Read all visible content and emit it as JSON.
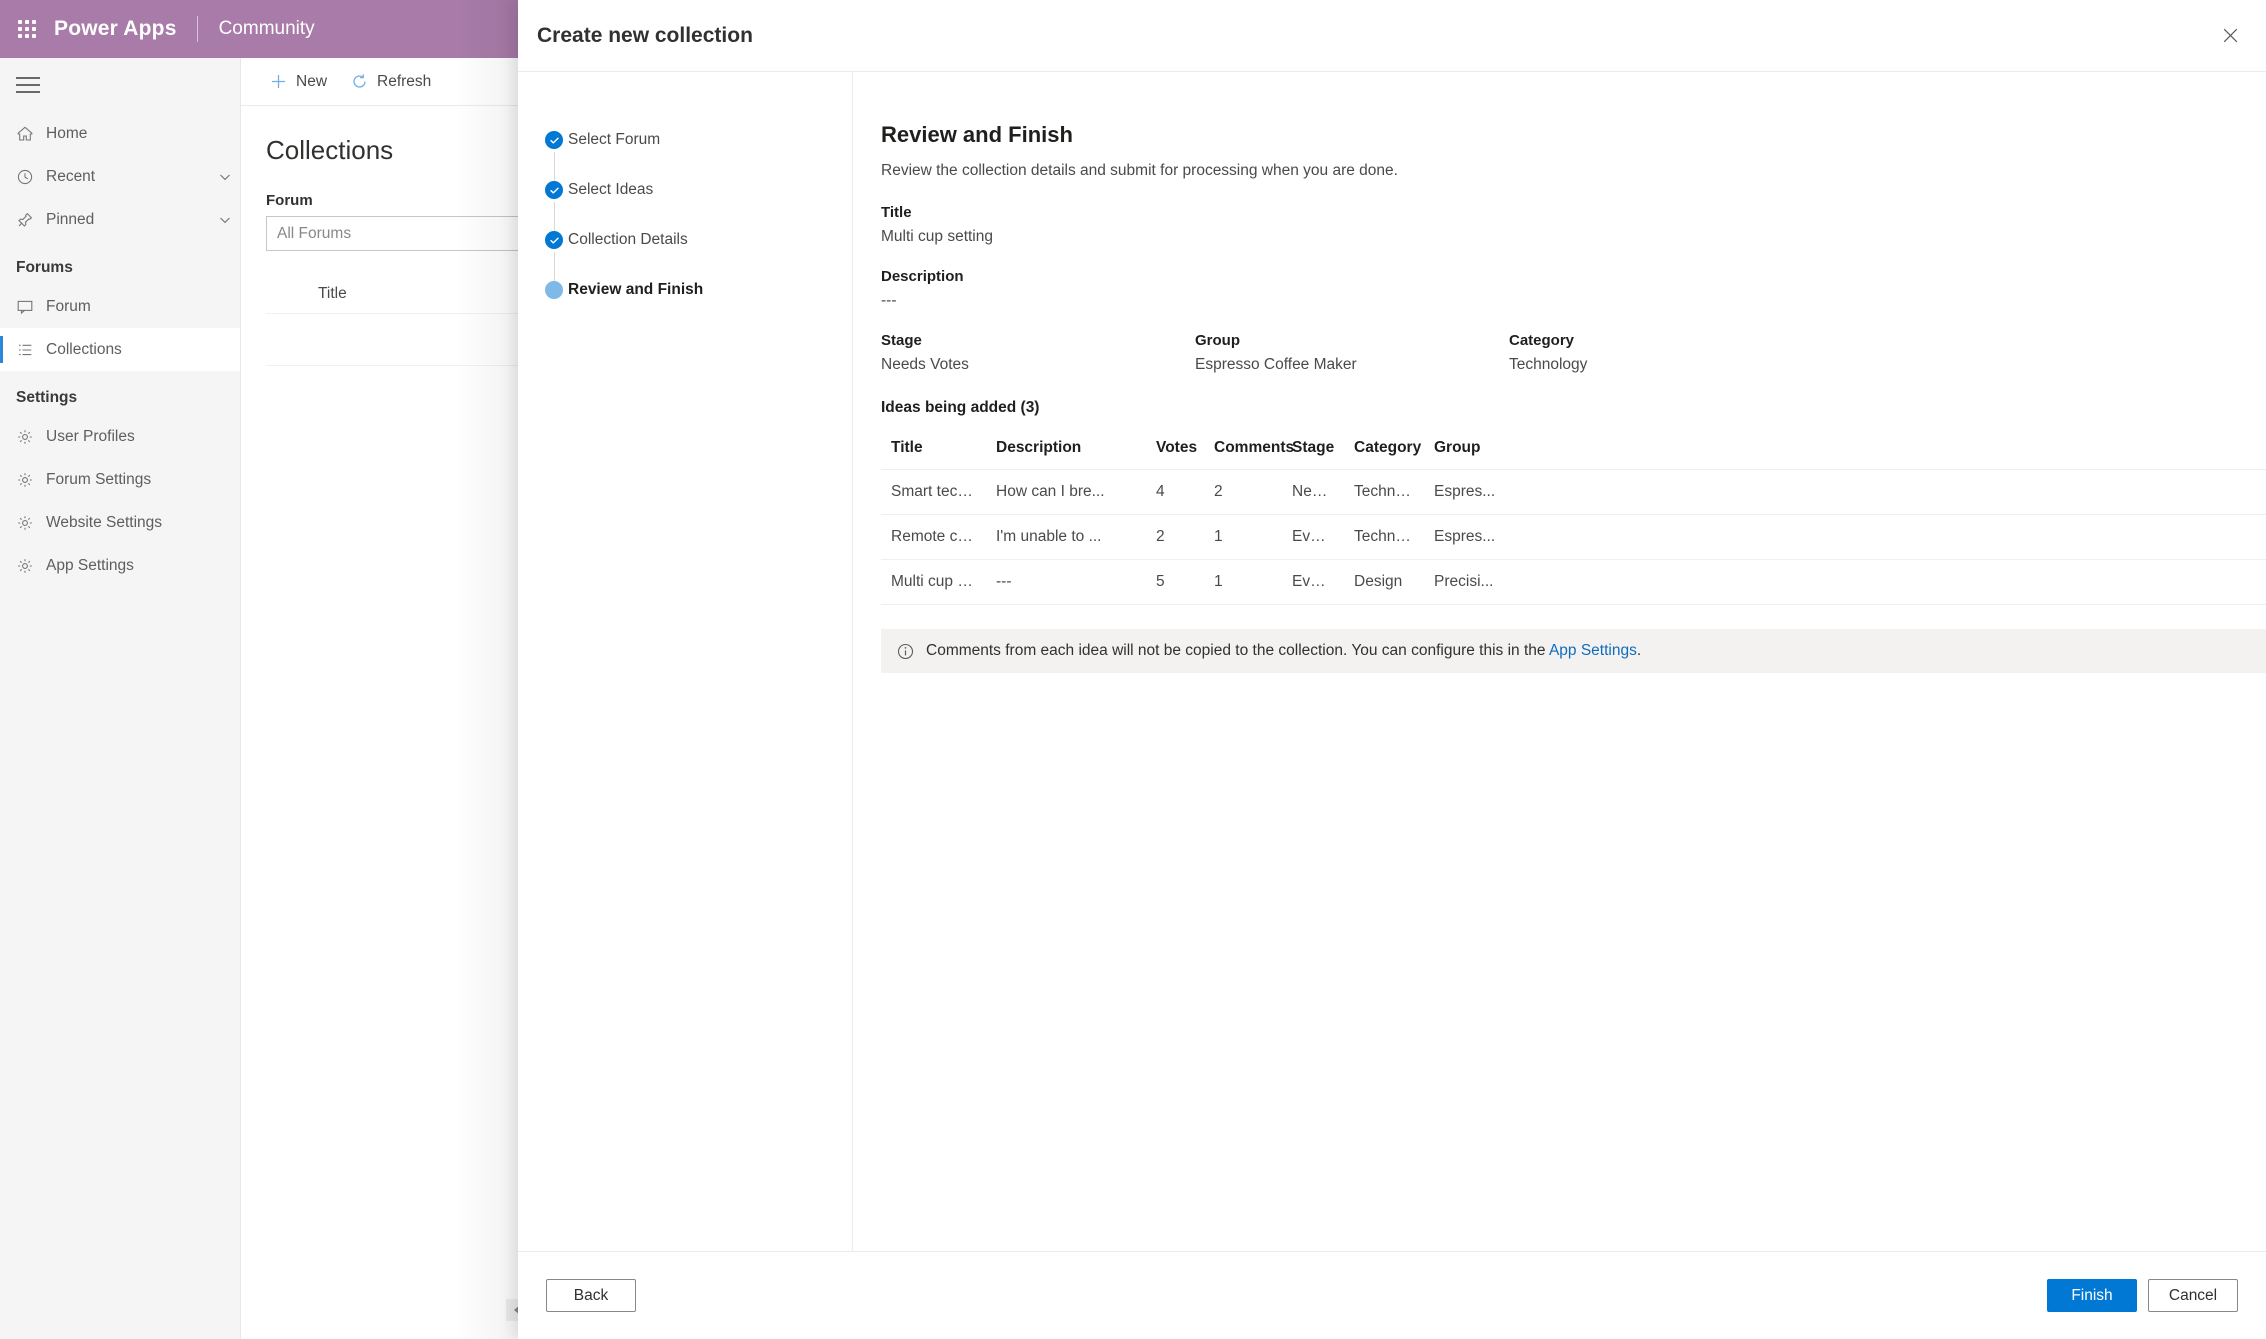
{
  "topbar": {
    "waffle_icon": "waffle-grid-icon",
    "brand": "Power Apps",
    "sub_brand": "Community",
    "bg_color": "#a87ba8"
  },
  "sidebar": {
    "menu_icon": "hamburger-icon",
    "items": [
      {
        "label": "Home",
        "icon": "home-icon",
        "chevron": false,
        "selected": false
      },
      {
        "label": "Recent",
        "icon": "clock-icon",
        "chevron": true,
        "selected": false
      },
      {
        "label": "Pinned",
        "icon": "pin-icon",
        "chevron": true,
        "selected": false
      }
    ],
    "group_forums": "Forums",
    "forum_items": [
      {
        "label": "Forum",
        "icon": "chat-icon",
        "selected": false
      },
      {
        "label": "Collections",
        "icon": "list-icon",
        "selected": true
      }
    ],
    "group_settings": "Settings",
    "settings_items": [
      {
        "label": "User Profiles",
        "icon": "gear-icon"
      },
      {
        "label": "Forum Settings",
        "icon": "gear-icon"
      },
      {
        "label": "Website Settings",
        "icon": "gear-icon"
      },
      {
        "label": "App Settings",
        "icon": "gear-icon"
      }
    ]
  },
  "main": {
    "commands": [
      {
        "label": "New",
        "icon": "plus-icon"
      },
      {
        "label": "Refresh",
        "icon": "refresh-icon"
      }
    ],
    "page_title": "Collections",
    "forum_field_label": "Forum",
    "forum_value": "All Forums",
    "list_column_title": "Title"
  },
  "dialog": {
    "title": "Create new collection",
    "close_icon": "close-icon",
    "steps": [
      {
        "label": "Select Forum",
        "state": "done"
      },
      {
        "label": "Select Ideas",
        "state": "done"
      },
      {
        "label": "Collection Details",
        "state": "done"
      },
      {
        "label": "Review and Finish",
        "state": "current"
      }
    ],
    "section_title": "Review and Finish",
    "section_subtitle": "Review the collection details and submit for processing when you are done.",
    "fields": {
      "title_label": "Title",
      "title_value": "Multi cup setting",
      "description_label": "Description",
      "description_value": "---",
      "stage_label": "Stage",
      "stage_value": "Needs Votes",
      "group_label": "Group",
      "group_value": "Espresso Coffee Maker",
      "category_label": "Category",
      "category_value": "Technology"
    },
    "ideas_heading": "Ideas being added (3)",
    "table": {
      "columns": [
        "Title",
        "Description",
        "Votes",
        "Comments",
        "Stage",
        "Category",
        "Group"
      ],
      "rows": [
        [
          "Smart technol...",
          "How can I bre...",
          "4",
          "2",
          "Needs...",
          "Technology",
          "Espres..."
        ],
        [
          "Remote control",
          "I'm unable to ...",
          "2",
          "1",
          "Evalua...",
          "Technology",
          "Espres..."
        ],
        [
          "Multi cup setti...",
          "---",
          "5",
          "1",
          "Evalua...",
          "Design",
          "Precisi..."
        ]
      ]
    },
    "info": {
      "icon": "info-icon",
      "text_before": "Comments from each idea will not be copied to the collection. You can configure this in the ",
      "link": "App Settings",
      "text_after": "."
    },
    "footer": {
      "back": "Back",
      "finish": "Finish",
      "cancel": "Cancel",
      "primary_color": "#0078d4"
    }
  }
}
